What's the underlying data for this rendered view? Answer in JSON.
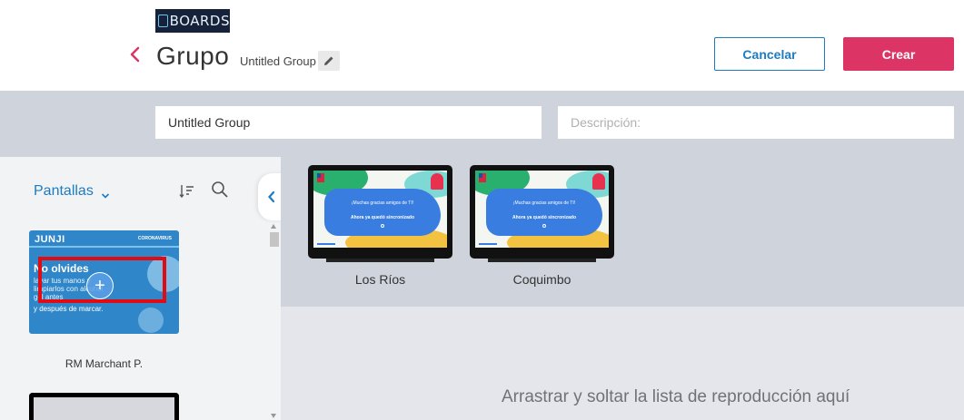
{
  "app": {
    "logo_text": "BOARDS"
  },
  "header": {
    "title": "Grupo",
    "subtitle": "Untitled Group *",
    "cancel_label": "Cancelar",
    "create_label": "Crear"
  },
  "form": {
    "name_value": "Untitled Group",
    "description_placeholder": "Descripción:"
  },
  "panel": {
    "dropdown_label": "Pantallas",
    "screens": [
      {
        "name": "RM Marchant P.",
        "thumb_logo": "JUNJI",
        "thumb_corner": "CORONAVIRUS",
        "thumb_headline": "No olvides",
        "thumb_body": "lavar tus manos y limpiarlos con alcohol gel antes",
        "thumb_bottom": "y después de marcar.",
        "add_symbol": "+"
      }
    ]
  },
  "group_screens": [
    {
      "name": "Los Ríos",
      "thumb_line1": "¡Muchas gracias amigos de TI!",
      "thumb_line2": "Ahora ya quedó sincronizado"
    },
    {
      "name": "Coquimbo",
      "thumb_line1": "¡Muchas gracias amigos de TI!",
      "thumb_line2": "Ahora ya quedó sincronizado"
    }
  ],
  "playlist": {
    "drop_hint": "Arrastrar y soltar la lista de reproducción aquí"
  },
  "colors": {
    "accent_blue": "#1d7bc0",
    "create_pink": "#dc3565",
    "highlight_red": "#e00b13",
    "band_gray": "#cfd3dc"
  }
}
